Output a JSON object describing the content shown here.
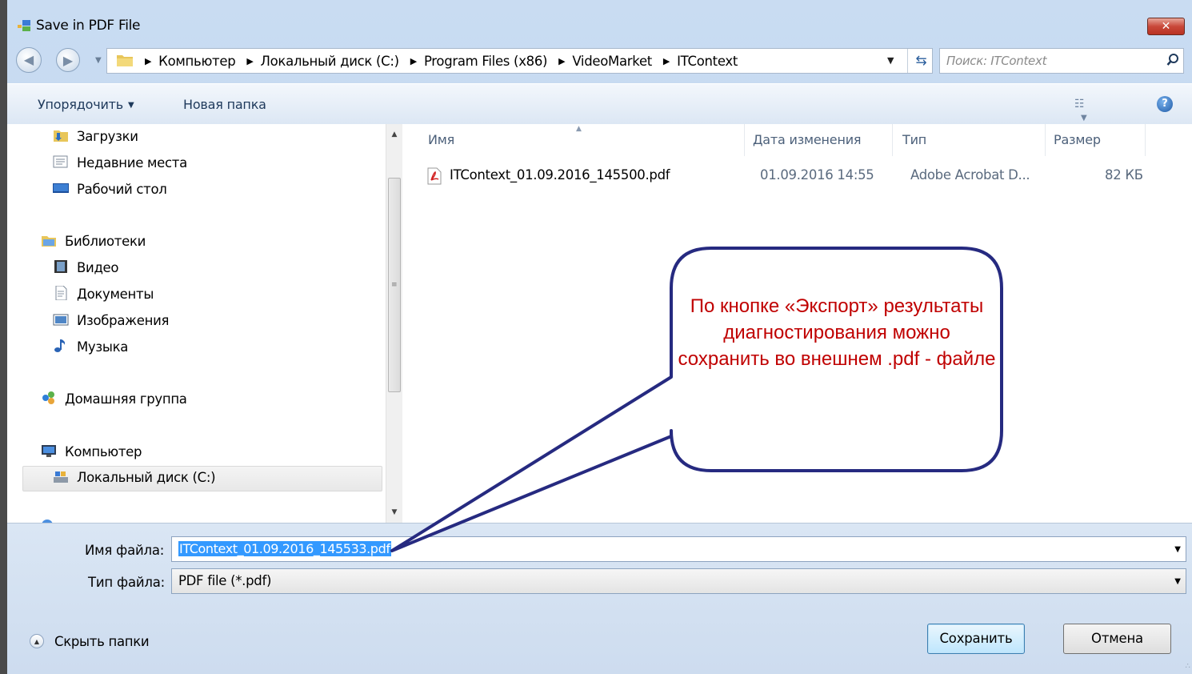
{
  "window": {
    "title": "Save in PDF File",
    "close_label": "✕"
  },
  "address": {
    "crumbs": [
      "Компьютер",
      "Локальный диск (C:)",
      "Program Files (x86)",
      "VideoMarket",
      "ITContext"
    ]
  },
  "search": {
    "placeholder": "Поиск: ITContext"
  },
  "toolbar": {
    "organize_label": "Упорядочить",
    "new_folder_label": "Новая папка"
  },
  "nav": {
    "items": [
      {
        "label": "Загрузки",
        "icon": "downloads-folder-icon"
      },
      {
        "label": "Недавние места",
        "icon": "recent-places-icon"
      },
      {
        "label": "Рабочий стол",
        "icon": "desktop-icon"
      },
      {
        "label": "Библиотеки",
        "icon": "libraries-icon"
      },
      {
        "label": "Видео",
        "icon": "video-icon"
      },
      {
        "label": "Документы",
        "icon": "documents-icon"
      },
      {
        "label": "Изображения",
        "icon": "pictures-icon"
      },
      {
        "label": "Музыка",
        "icon": "music-icon"
      },
      {
        "label": "Домашняя группа",
        "icon": "homegroup-icon"
      },
      {
        "label": "Компьютер",
        "icon": "computer-icon"
      },
      {
        "label": "Локальный диск (C:)",
        "icon": "local-disk-icon",
        "selected": true
      }
    ]
  },
  "files": {
    "columns": [
      "Имя",
      "Дата изменения",
      "Тип",
      "Размер"
    ],
    "rows": [
      {
        "name": "ITContext_01.09.2016_145500.pdf",
        "date": "01.09.2016 14:55",
        "type": "Adobe Acrobat D...",
        "size": "82 КБ",
        "icon": "pdf-file-icon"
      }
    ]
  },
  "form": {
    "filename_label": "Имя файла:",
    "filename_value": "ITContext_01.09.2016_145533.pdf",
    "filetype_label": "Тип файла:",
    "filetype_value": "PDF file (*.pdf)"
  },
  "footer": {
    "hide_folders_label": "Скрыть папки",
    "save_label": "Сохранить",
    "cancel_label": "Отмена"
  },
  "callout": {
    "text": "По кнопке «Экспорт» результаты диагностирования можно сохранить во внешнем .pdf - файле"
  },
  "colors": {
    "callout_border": "#262a80",
    "callout_text": "#c00000",
    "selection": "#3399ff"
  }
}
